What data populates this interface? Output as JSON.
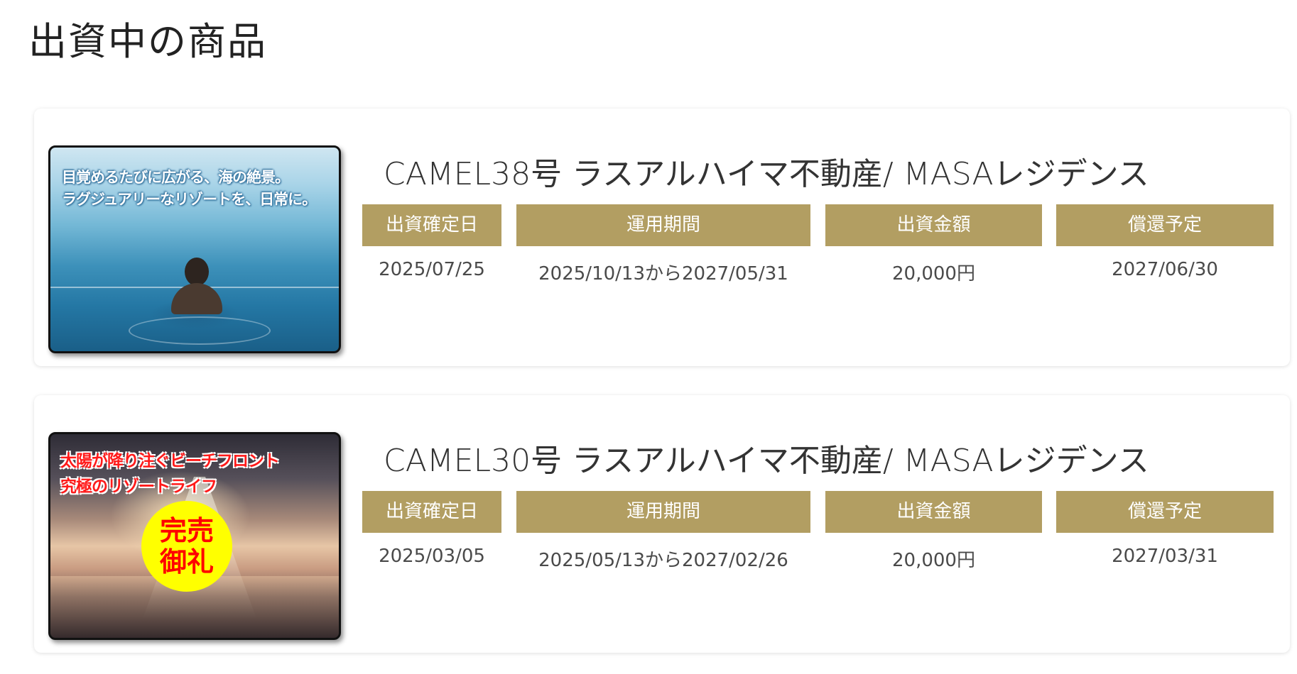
{
  "page": {
    "title": "出資中の商品"
  },
  "colors": {
    "header_bg": "#b29e62",
    "header_text": "#ffffff",
    "card_bg": "#ffffff",
    "sold_badge": "#ffff00",
    "sold_text": "#ff0000"
  },
  "headers": {
    "confirm_date": "出資確定日",
    "period": "運用期間",
    "amount": "出資金額",
    "redemption": "償還予定"
  },
  "products": [
    {
      "name": "CAMEL38号 ラスアルハイマ不動産/ MASAレジデンス",
      "image": {
        "caption_line1": "目覚めるたびに広がる、海の絶景。",
        "caption_line2": "ラグジュアリーなリゾートを、日常に。",
        "scene": "woman-in-infinity-pool"
      },
      "confirm_date": "2025/07/25",
      "period": "2025/10/13から2027/05/31",
      "amount": "20,000円",
      "redemption": "2027/06/30"
    },
    {
      "name": "CAMEL30号 ラスアルハイマ不動産/ MASAレジデンス",
      "image": {
        "caption_line1": "太陽が降り注ぐビーチフロント",
        "caption_line2": "究極のリゾートライフ",
        "badge_line1": "完売",
        "badge_line2": "御礼",
        "scene": "sunset-beach"
      },
      "confirm_date": "2025/03/05",
      "period": "2025/05/13から2027/02/26",
      "amount": "20,000円",
      "redemption": "2027/03/31"
    }
  ]
}
